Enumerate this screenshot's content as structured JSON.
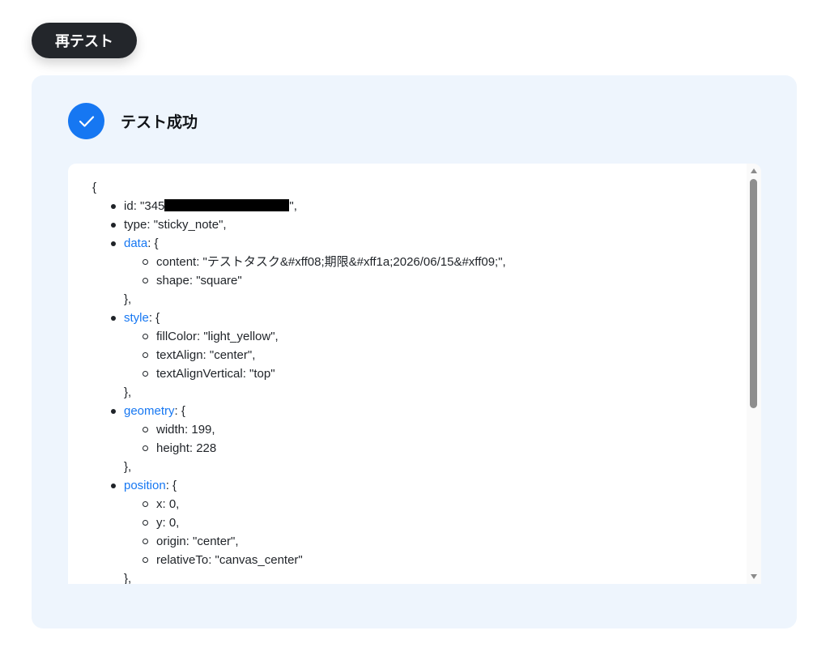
{
  "retest_button": {
    "label": "再テスト"
  },
  "status": {
    "text": "テスト成功",
    "icon": "check-icon",
    "accent_color": "#1677f2"
  },
  "json": {
    "open_brace": "{",
    "id": {
      "key": "id",
      "sep": ": ",
      "value_prefix": "\"345",
      "value_suffix": "\","
    },
    "type": {
      "key": "type",
      "sep": ": ",
      "value": "\"sticky_note\","
    },
    "data": {
      "key": "data",
      "sep": ": {",
      "fields": [
        {
          "text": "content: \"テストタスク&#xff08;期限&#xff1a;2026/06/15&#xff09;\","
        },
        {
          "text": "shape: \"square\""
        }
      ],
      "close": "},"
    },
    "style": {
      "key": "style",
      "sep": ": {",
      "fields": [
        {
          "text": "fillColor: \"light_yellow\","
        },
        {
          "text": "textAlign: \"center\","
        },
        {
          "text": "textAlignVertical: \"top\""
        }
      ],
      "close": "},"
    },
    "geometry": {
      "key": "geometry",
      "sep": ": {",
      "fields": [
        {
          "text": "width: 199,"
        },
        {
          "text": "height: 228"
        }
      ],
      "close": "},"
    },
    "position": {
      "key": "position",
      "sep": ": {",
      "fields": [
        {
          "text": "x: 0,"
        },
        {
          "text": "y: 0,"
        },
        {
          "text": "origin: \"center\","
        },
        {
          "text": "relativeTo: \"canvas_center\""
        }
      ],
      "close": "},"
    }
  }
}
